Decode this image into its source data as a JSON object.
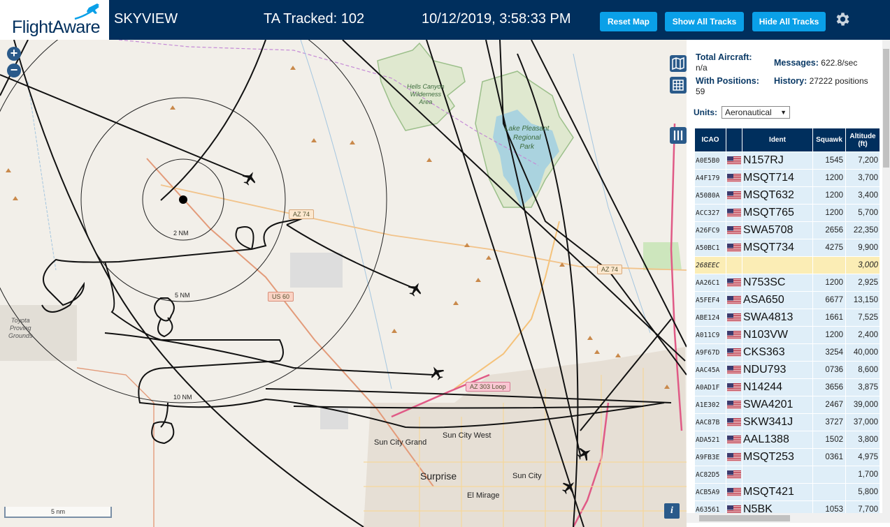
{
  "header": {
    "logo_text": "FlightAware",
    "site_name": "SKYVIEW",
    "ta_tracked": "TA Tracked: 102",
    "clock": "10/12/2019, 3:58:33 PM",
    "buttons": {
      "reset": "Reset Map",
      "show": "Show All Tracks",
      "hide": "Hide All Tracks"
    },
    "brand_color": "#002f5d",
    "button_color": "#0aa0e8"
  },
  "map": {
    "range_labels": [
      "2 NM",
      "5 NM",
      "10 NM"
    ],
    "road_labels": [
      "AZ 74",
      "US 60",
      "AZ 303 Loop",
      "AZ 74"
    ],
    "place_labels": {
      "hells_canyon": [
        "Hells Canyon",
        "Wilderness",
        "Area"
      ],
      "lake_pleasant": [
        "Lake Pleasant",
        "Regional",
        "Park"
      ],
      "toyota": [
        "Toyota",
        "Proving",
        "Grounds"
      ],
      "sun_city_grand": "Sun City Grand",
      "sun_city_west": "Sun City West",
      "surprise": "Surprise",
      "sun_city": "Sun City",
      "el_mirage": "El Mirage"
    },
    "scale": "5 nm",
    "zoom_in": "+",
    "zoom_out": "−",
    "info": "i"
  },
  "stats": {
    "total_label": "Total Aircraft:",
    "total_value": "n/a",
    "positions_label": "With Positions:",
    "positions_value": "59",
    "messages_label": "Messages:",
    "messages_value": "622.8/sec",
    "history_label": "History:",
    "history_value": "27222 positions"
  },
  "units": {
    "label": "Units:",
    "selected": "Aeronautical"
  },
  "table": {
    "headers": [
      "ICAO",
      "",
      "Ident",
      "Squawk",
      "Altitude (ft)"
    ],
    "rows": [
      {
        "icao": "A0E5B0",
        "ident": "N157RJ",
        "squawk": "1545",
        "alt": "7,200",
        "flag": true
      },
      {
        "icao": "A4F179",
        "ident": "MSQT714",
        "squawk": "1200",
        "alt": "3,700",
        "flag": true
      },
      {
        "icao": "A5080A",
        "ident": "MSQT632",
        "squawk": "1200",
        "alt": "3,400",
        "flag": true
      },
      {
        "icao": "ACC327",
        "ident": "MSQT765",
        "squawk": "1200",
        "alt": "5,700",
        "flag": true
      },
      {
        "icao": "A26FC9",
        "ident": "SWA5708",
        "squawk": "2656",
        "alt": "22,350",
        "flag": true
      },
      {
        "icao": "A50BC1",
        "ident": "MSQT734",
        "squawk": "4275",
        "alt": "9,900",
        "flag": true
      },
      {
        "icao": "268EEC",
        "ident": "",
        "squawk": "",
        "alt": "3,000",
        "flag": false,
        "highlight": true
      },
      {
        "icao": "AA26C1",
        "ident": "N753SC",
        "squawk": "1200",
        "alt": "2,925",
        "flag": true
      },
      {
        "icao": "A5FEF4",
        "ident": "ASA650",
        "squawk": "6677",
        "alt": "13,150",
        "flag": true
      },
      {
        "icao": "ABE124",
        "ident": "SWA4813",
        "squawk": "1661",
        "alt": "7,525",
        "flag": true
      },
      {
        "icao": "A011C9",
        "ident": "N103VW",
        "squawk": "1200",
        "alt": "2,400",
        "flag": true
      },
      {
        "icao": "A9F67D",
        "ident": "CKS363",
        "squawk": "3254",
        "alt": "40,000",
        "flag": true
      },
      {
        "icao": "AAC45A",
        "ident": "NDU793",
        "squawk": "0736",
        "alt": "8,600",
        "flag": true
      },
      {
        "icao": "A0AD1F",
        "ident": "N14244",
        "squawk": "3656",
        "alt": "3,875",
        "flag": true
      },
      {
        "icao": "A1E302",
        "ident": "SWA4201",
        "squawk": "2467",
        "alt": "39,000",
        "flag": true
      },
      {
        "icao": "AAC87B",
        "ident": "SKW341J",
        "squawk": "3727",
        "alt": "37,000",
        "flag": true
      },
      {
        "icao": "ADA521",
        "ident": "AAL1388",
        "squawk": "1502",
        "alt": "3,800",
        "flag": true
      },
      {
        "icao": "A9FB3E",
        "ident": "MSQT253",
        "squawk": "0361",
        "alt": "4,975",
        "flag": true
      },
      {
        "icao": "AC82D5",
        "ident": "",
        "squawk": "",
        "alt": "1,700",
        "flag": true
      },
      {
        "icao": "ACB5A9",
        "ident": "MSQT421",
        "squawk": "",
        "alt": "5,800",
        "flag": true
      },
      {
        "icao": "A63561",
        "ident": "N5BK",
        "squawk": "1053",
        "alt": "7,700",
        "flag": true
      }
    ]
  }
}
